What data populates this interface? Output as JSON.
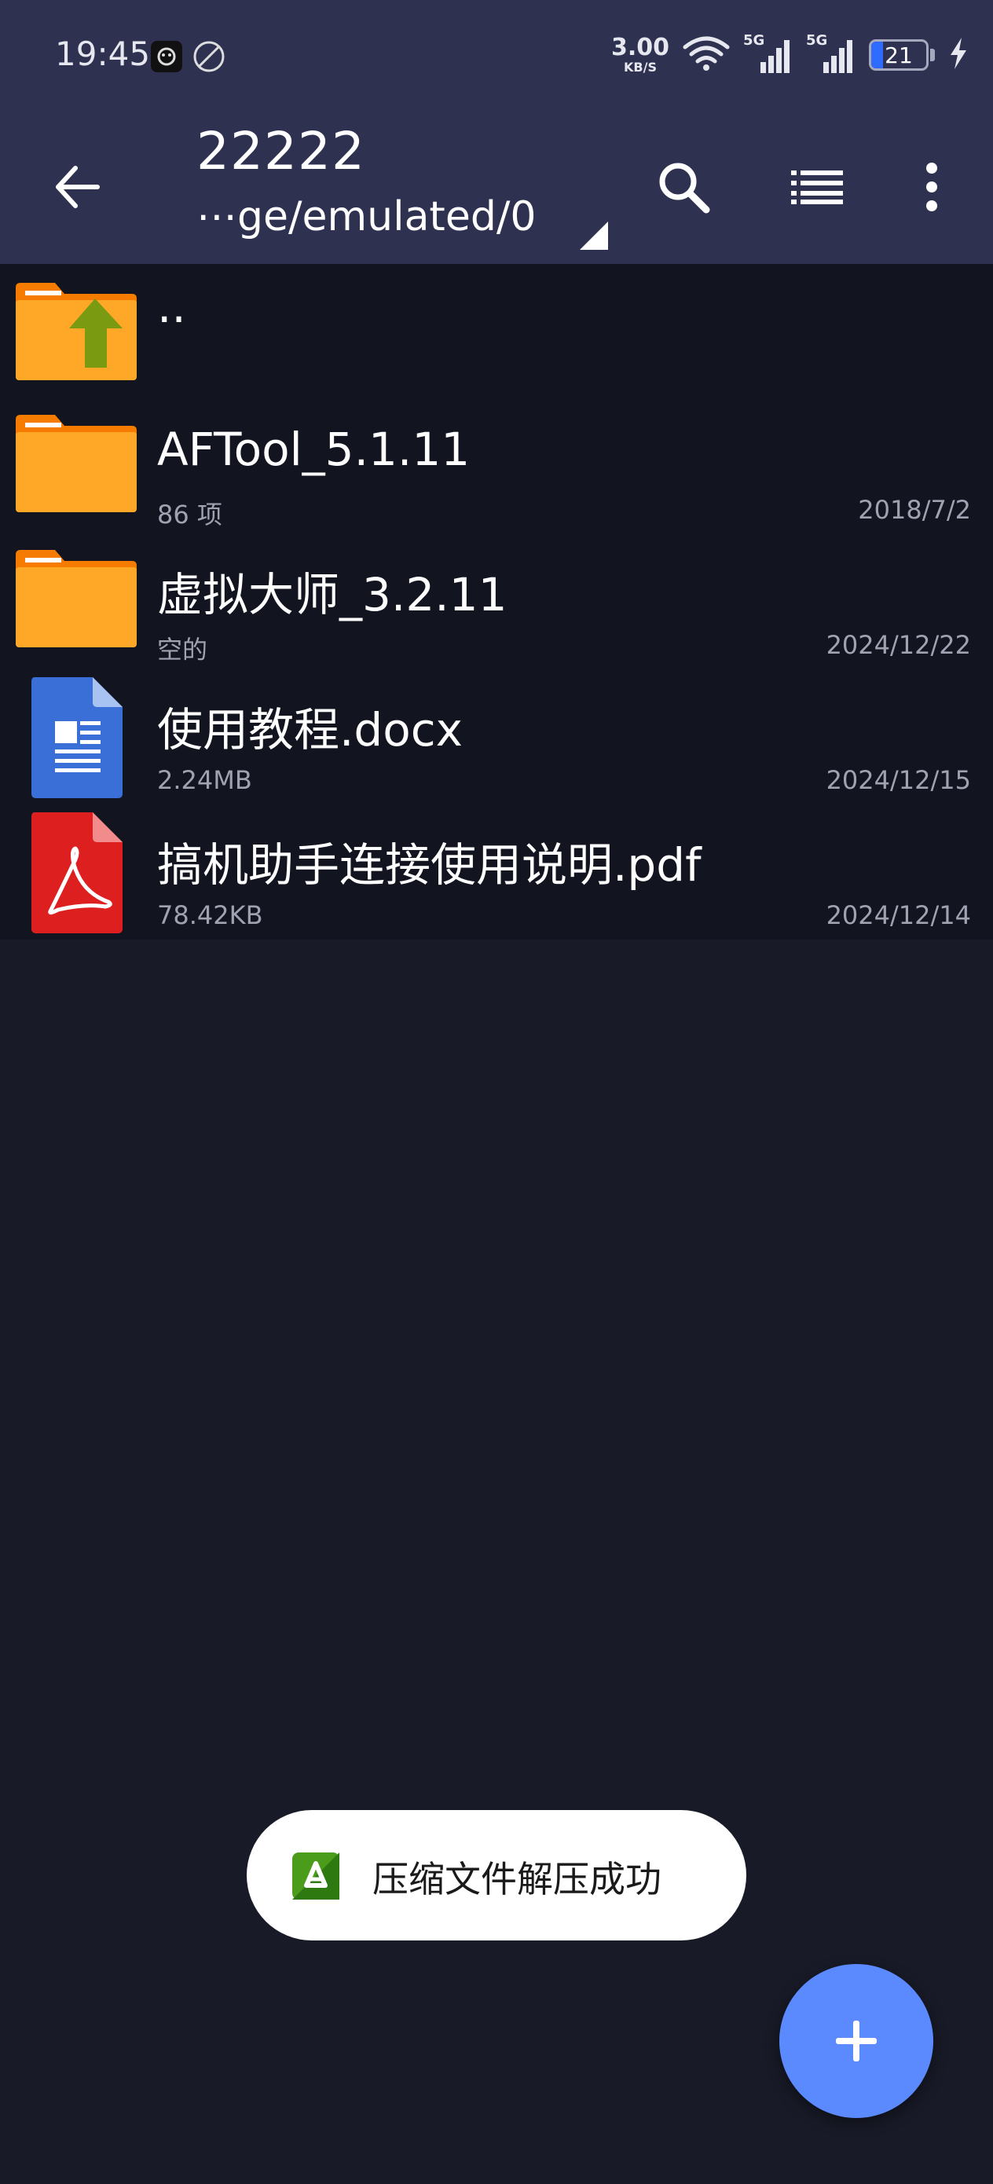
{
  "status_bar": {
    "time": "19:45",
    "net_speed_value": "3.00",
    "net_speed_unit": "KB/S",
    "network_1": "5G",
    "network_2": "5G",
    "battery_level": "21",
    "battery_fraction": 0.21,
    "icons": [
      "notification-app-icon",
      "no-ads-icon",
      "wifi-icon",
      "signal-icon",
      "battery-icon",
      "charging-icon"
    ]
  },
  "app_bar": {
    "title": "22222",
    "path": "⋯ge/emulated/0",
    "icons": [
      "back-arrow-icon",
      "search-icon",
      "list-view-icon",
      "more-vert-icon"
    ]
  },
  "files": [
    {
      "name": "..",
      "meta": "",
      "date": "",
      "type": "parent-folder"
    },
    {
      "name": "AFTool_5.1.11",
      "meta": "86 项",
      "date": "2018/7/2",
      "type": "folder"
    },
    {
      "name": "虚拟大师_3.2.11",
      "meta": "空的",
      "date": "2024/12/22",
      "type": "folder"
    },
    {
      "name": "使用教程.docx",
      "meta": "2.24MB",
      "date": "2024/12/15",
      "type": "docx"
    },
    {
      "name": "搞机助手连接使用说明.pdf",
      "meta": "78.42KB",
      "date": "2024/12/14",
      "type": "pdf"
    }
  ],
  "toast": {
    "message": "压缩文件解压成功",
    "icon": "zarchiver-logo-icon"
  },
  "fab": {
    "icon": "plus-icon"
  },
  "colors": {
    "app_bar": "#2e3150",
    "list_background": "#121420",
    "page_background": "#181a27",
    "folder": "#ffa726",
    "docx": "#3b6fd8",
    "pdf": "#dd1f1f",
    "fab": "#5b8aff"
  }
}
